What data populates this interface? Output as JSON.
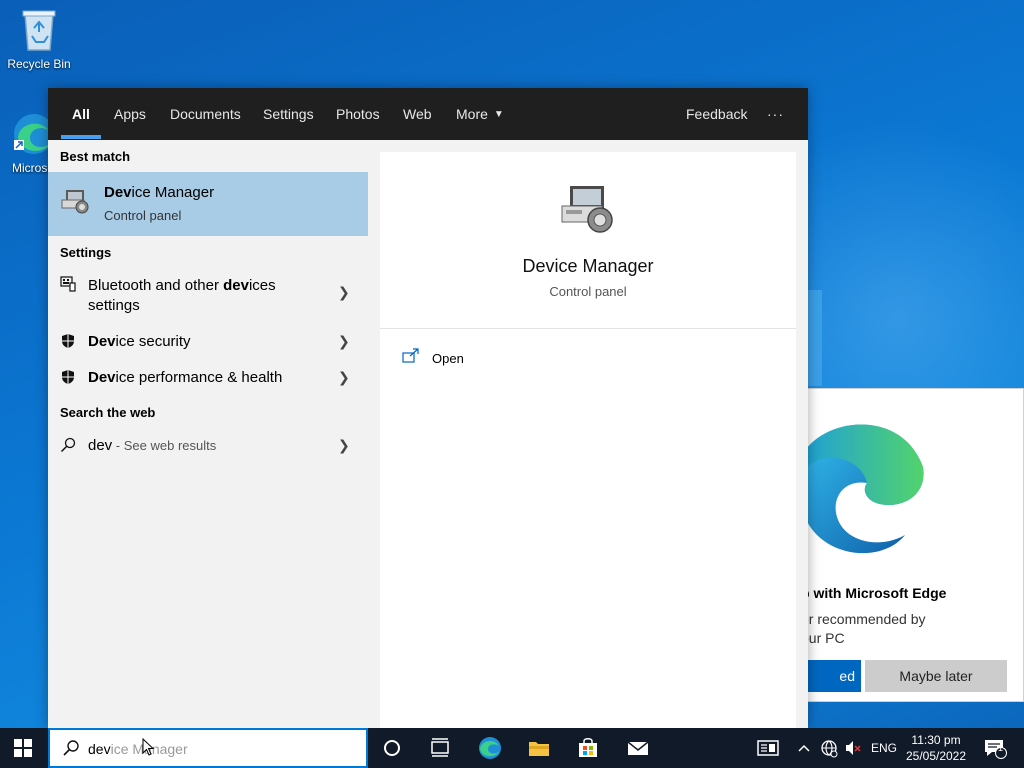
{
  "desktop": {
    "icons": [
      {
        "label": "Recycle Bin"
      },
      {
        "label": "Microsoft Edge"
      }
    ]
  },
  "search": {
    "tabs": [
      "All",
      "Apps",
      "Documents",
      "Settings",
      "Photos",
      "Web",
      "More"
    ],
    "active_tab": "All",
    "feedback_label": "Feedback",
    "more_options_label": "···",
    "sections": {
      "best_match": "Best match",
      "settings": "Settings",
      "search_the_web": "Search the web"
    },
    "best_match": {
      "title_highlight": "Dev",
      "title_rest": "ice Manager",
      "subtitle": "Control panel"
    },
    "settings_results": [
      {
        "pre": "Bluetooth and other ",
        "bold": "dev",
        "post": "ices",
        "line2": "settings"
      },
      {
        "pre": "",
        "bold": "Dev",
        "post": "ice security"
      },
      {
        "pre": "",
        "bold": "Dev",
        "post": "ice performance & health"
      }
    ],
    "web_result": {
      "query": "dev",
      "suffix": " - See web results"
    },
    "preview": {
      "title": "Device Manager",
      "subtitle": "Control panel",
      "action_label": "Open"
    },
    "query_typed": "dev",
    "query_autocomplete": "ice Manager"
  },
  "edge_promo": {
    "title": "b with Microsoft Edge",
    "line1": "er recommended by",
    "line2": "our PC",
    "primary_button": "ed",
    "secondary_button": "Maybe later"
  },
  "taskbar": {
    "language": "ENG",
    "time": "11:30 pm",
    "date": "25/05/2022",
    "notification_count": "1"
  }
}
